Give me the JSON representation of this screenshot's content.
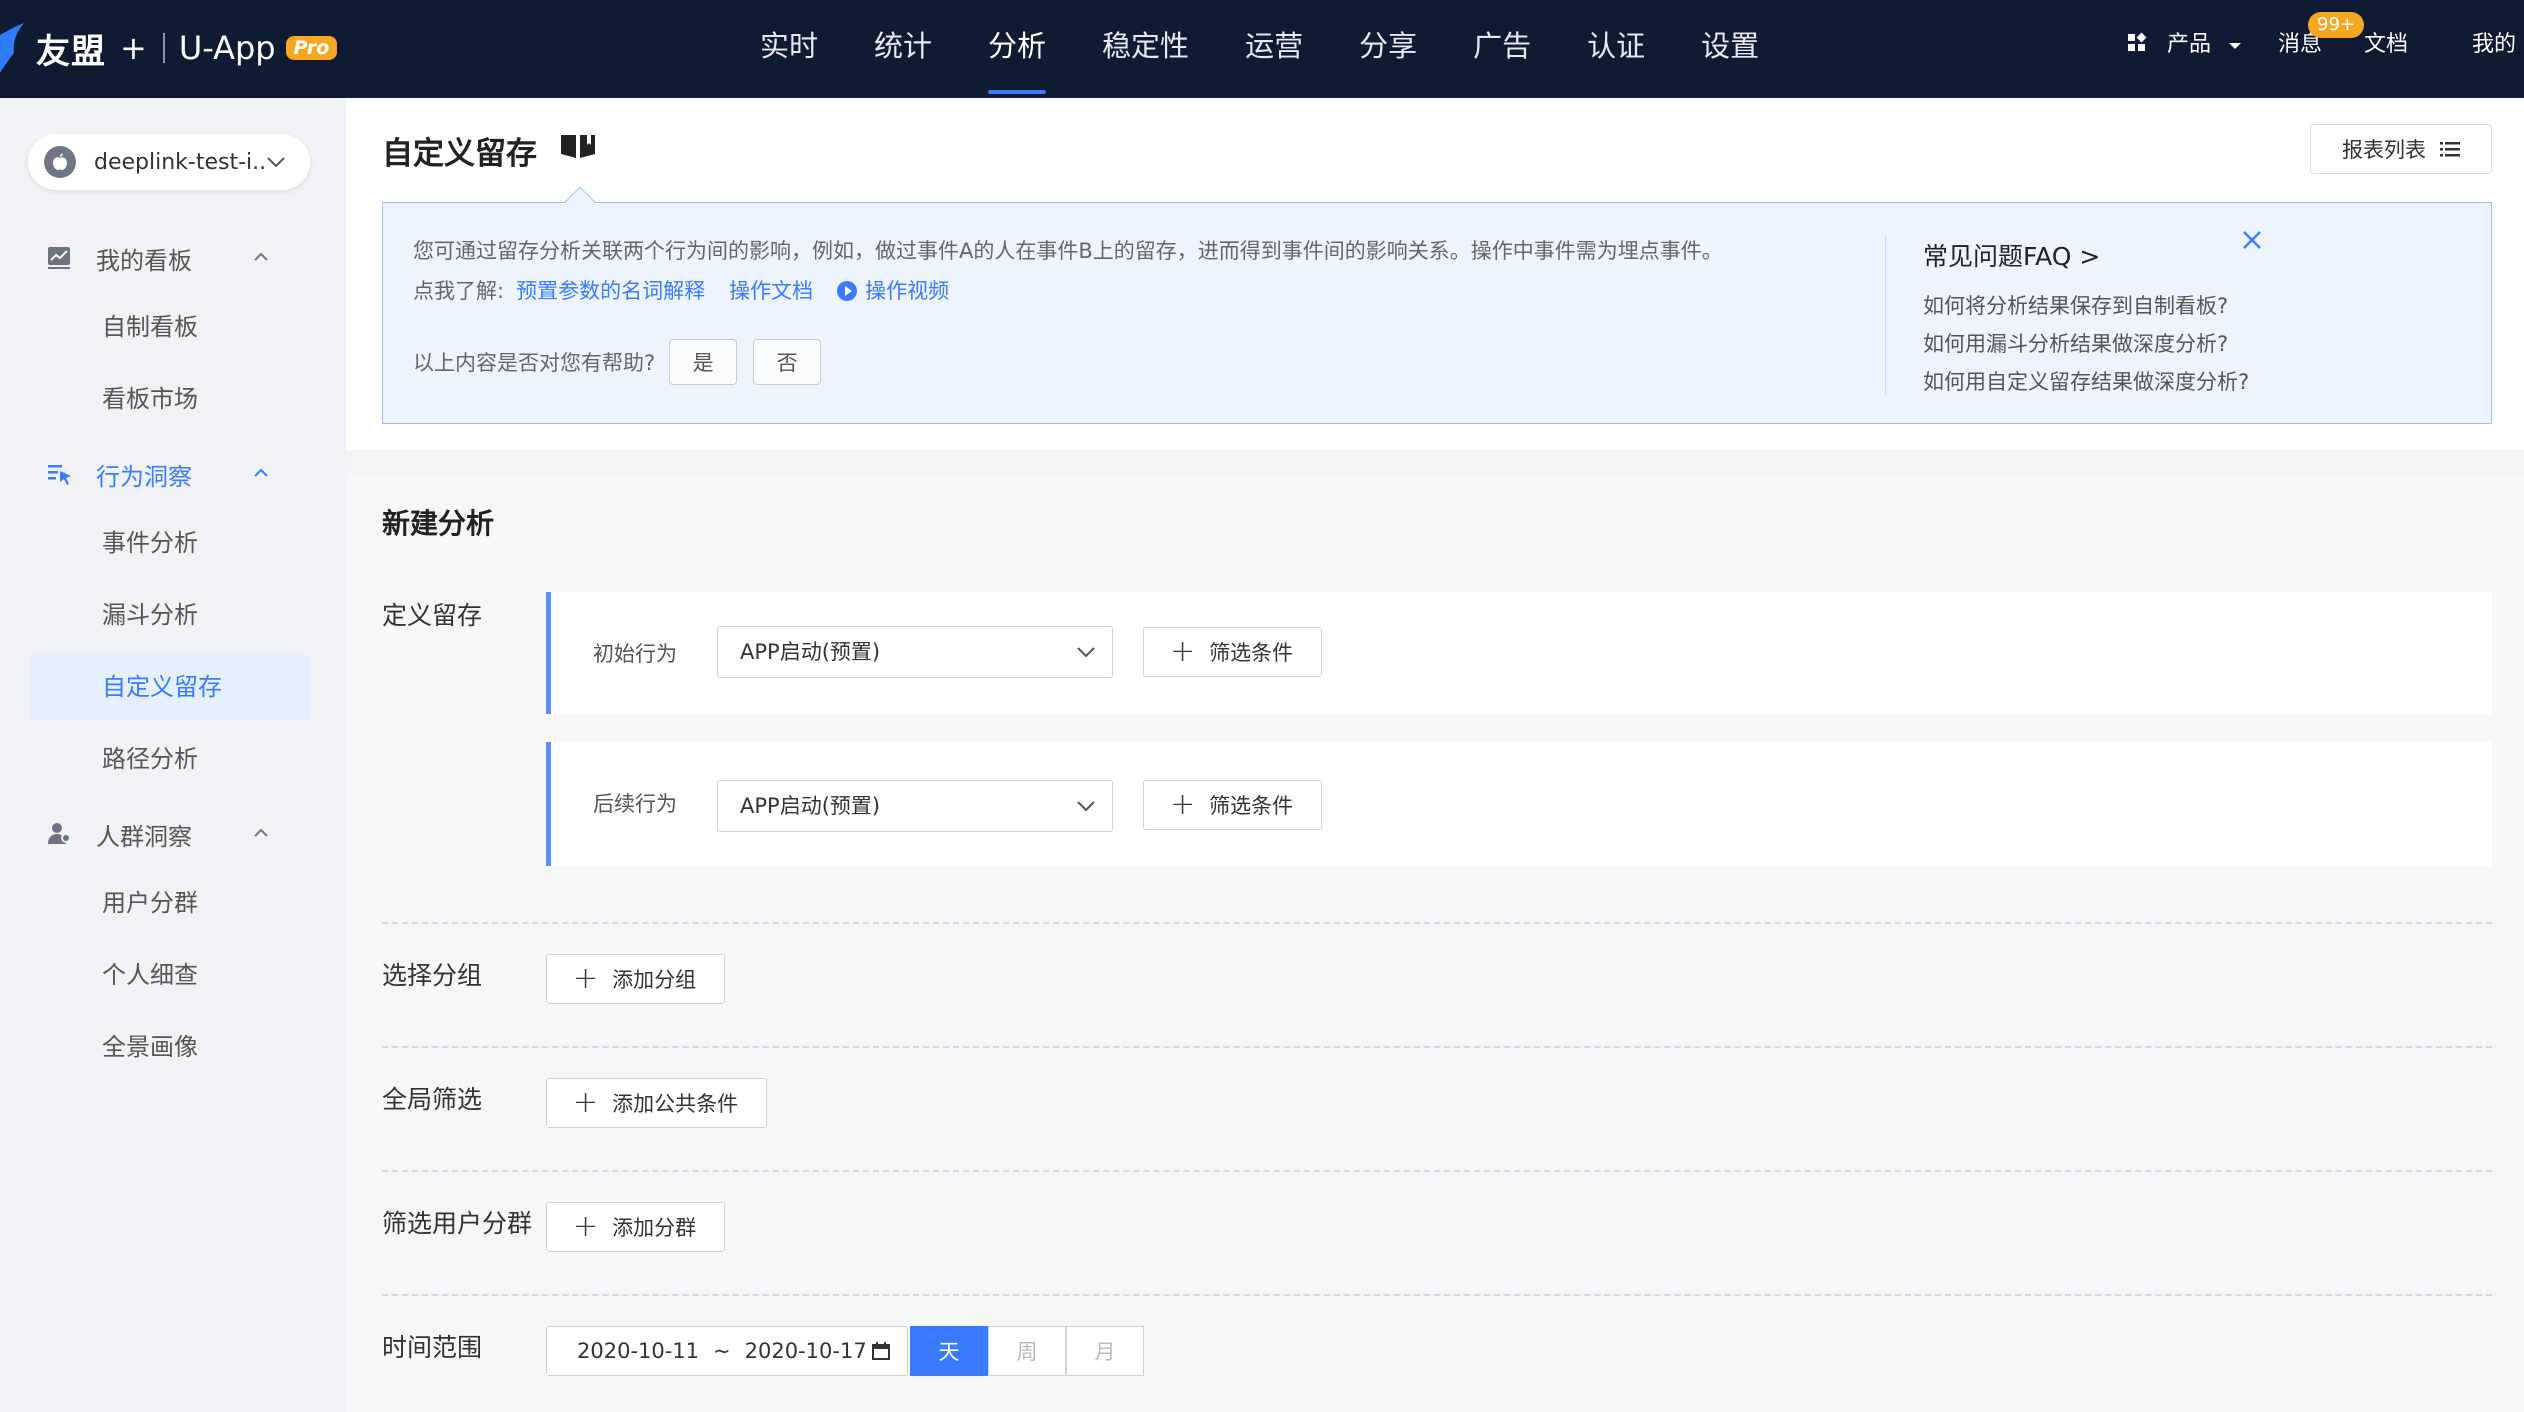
{
  "header": {
    "brand": "友盟",
    "plus": "+",
    "product": "U-App",
    "badge": "Pro",
    "nav": [
      "实时",
      "统计",
      "分析",
      "稳定性",
      "运营",
      "分享",
      "广告",
      "认证",
      "设置"
    ],
    "active_nav": "分析",
    "products_label": "产品",
    "messages_label": "消息",
    "messages_badge": "99+",
    "docs_label": "文档",
    "mine_label": "我的"
  },
  "sidebar": {
    "app_name": "deeplink-test-i...",
    "groups": [
      {
        "label": "我的看板",
        "icon": "chart-icon",
        "items": [
          "自制看板",
          "看板市场"
        ]
      },
      {
        "label": "行为洞察",
        "icon": "behavior-icon",
        "items": [
          "事件分析",
          "漏斗分析",
          "自定义留存",
          "路径分析"
        ]
      },
      {
        "label": "人群洞察",
        "icon": "user-group-icon",
        "items": [
          "用户分群",
          "个人细查",
          "全景画像"
        ]
      }
    ],
    "active_item": "自定义留存",
    "accent": "#3a7bfd"
  },
  "page": {
    "title": "自定义留存",
    "report_list_label": "报表列表"
  },
  "info": {
    "description": "您可通过留存分析关联两个行为间的影响，例如，做过事件A的人在事件B上的留存，进而得到事件间的影响关系。操作中事件需为埋点事件。",
    "learn_prefix": "点我了解:",
    "links": [
      "预置参数的名词解释",
      "操作文档",
      "操作视频"
    ],
    "helpful_question": "以上内容是否对您有帮助?",
    "yes": "是",
    "no": "否",
    "faq_title": "常见问题FAQ >",
    "faq_items": [
      "如何将分析结果保存到自制看板?",
      "如何用漏斗分析结果做深度分析?",
      "如何用自定义留存结果做深度分析?"
    ]
  },
  "analysis": {
    "section_title": "新建分析",
    "define_label": "定义留存",
    "initial_label": "初始行为",
    "initial_value": "APP启动(预置)",
    "followup_label": "后续行为",
    "followup_value": "APP启动(预置)",
    "filter_btn": "筛选条件",
    "group_label": "选择分组",
    "group_btn": "添加分组",
    "global_filter_label": "全局筛选",
    "global_filter_btn": "添加公共条件",
    "segment_label": "筛选用户分群",
    "segment_btn": "添加分群",
    "time_label": "时间范围",
    "date_start": "2020-10-11",
    "date_sep": "~",
    "date_end": "2020-10-17",
    "granularity": [
      "天",
      "周",
      "月"
    ],
    "active_granularity": "天"
  }
}
